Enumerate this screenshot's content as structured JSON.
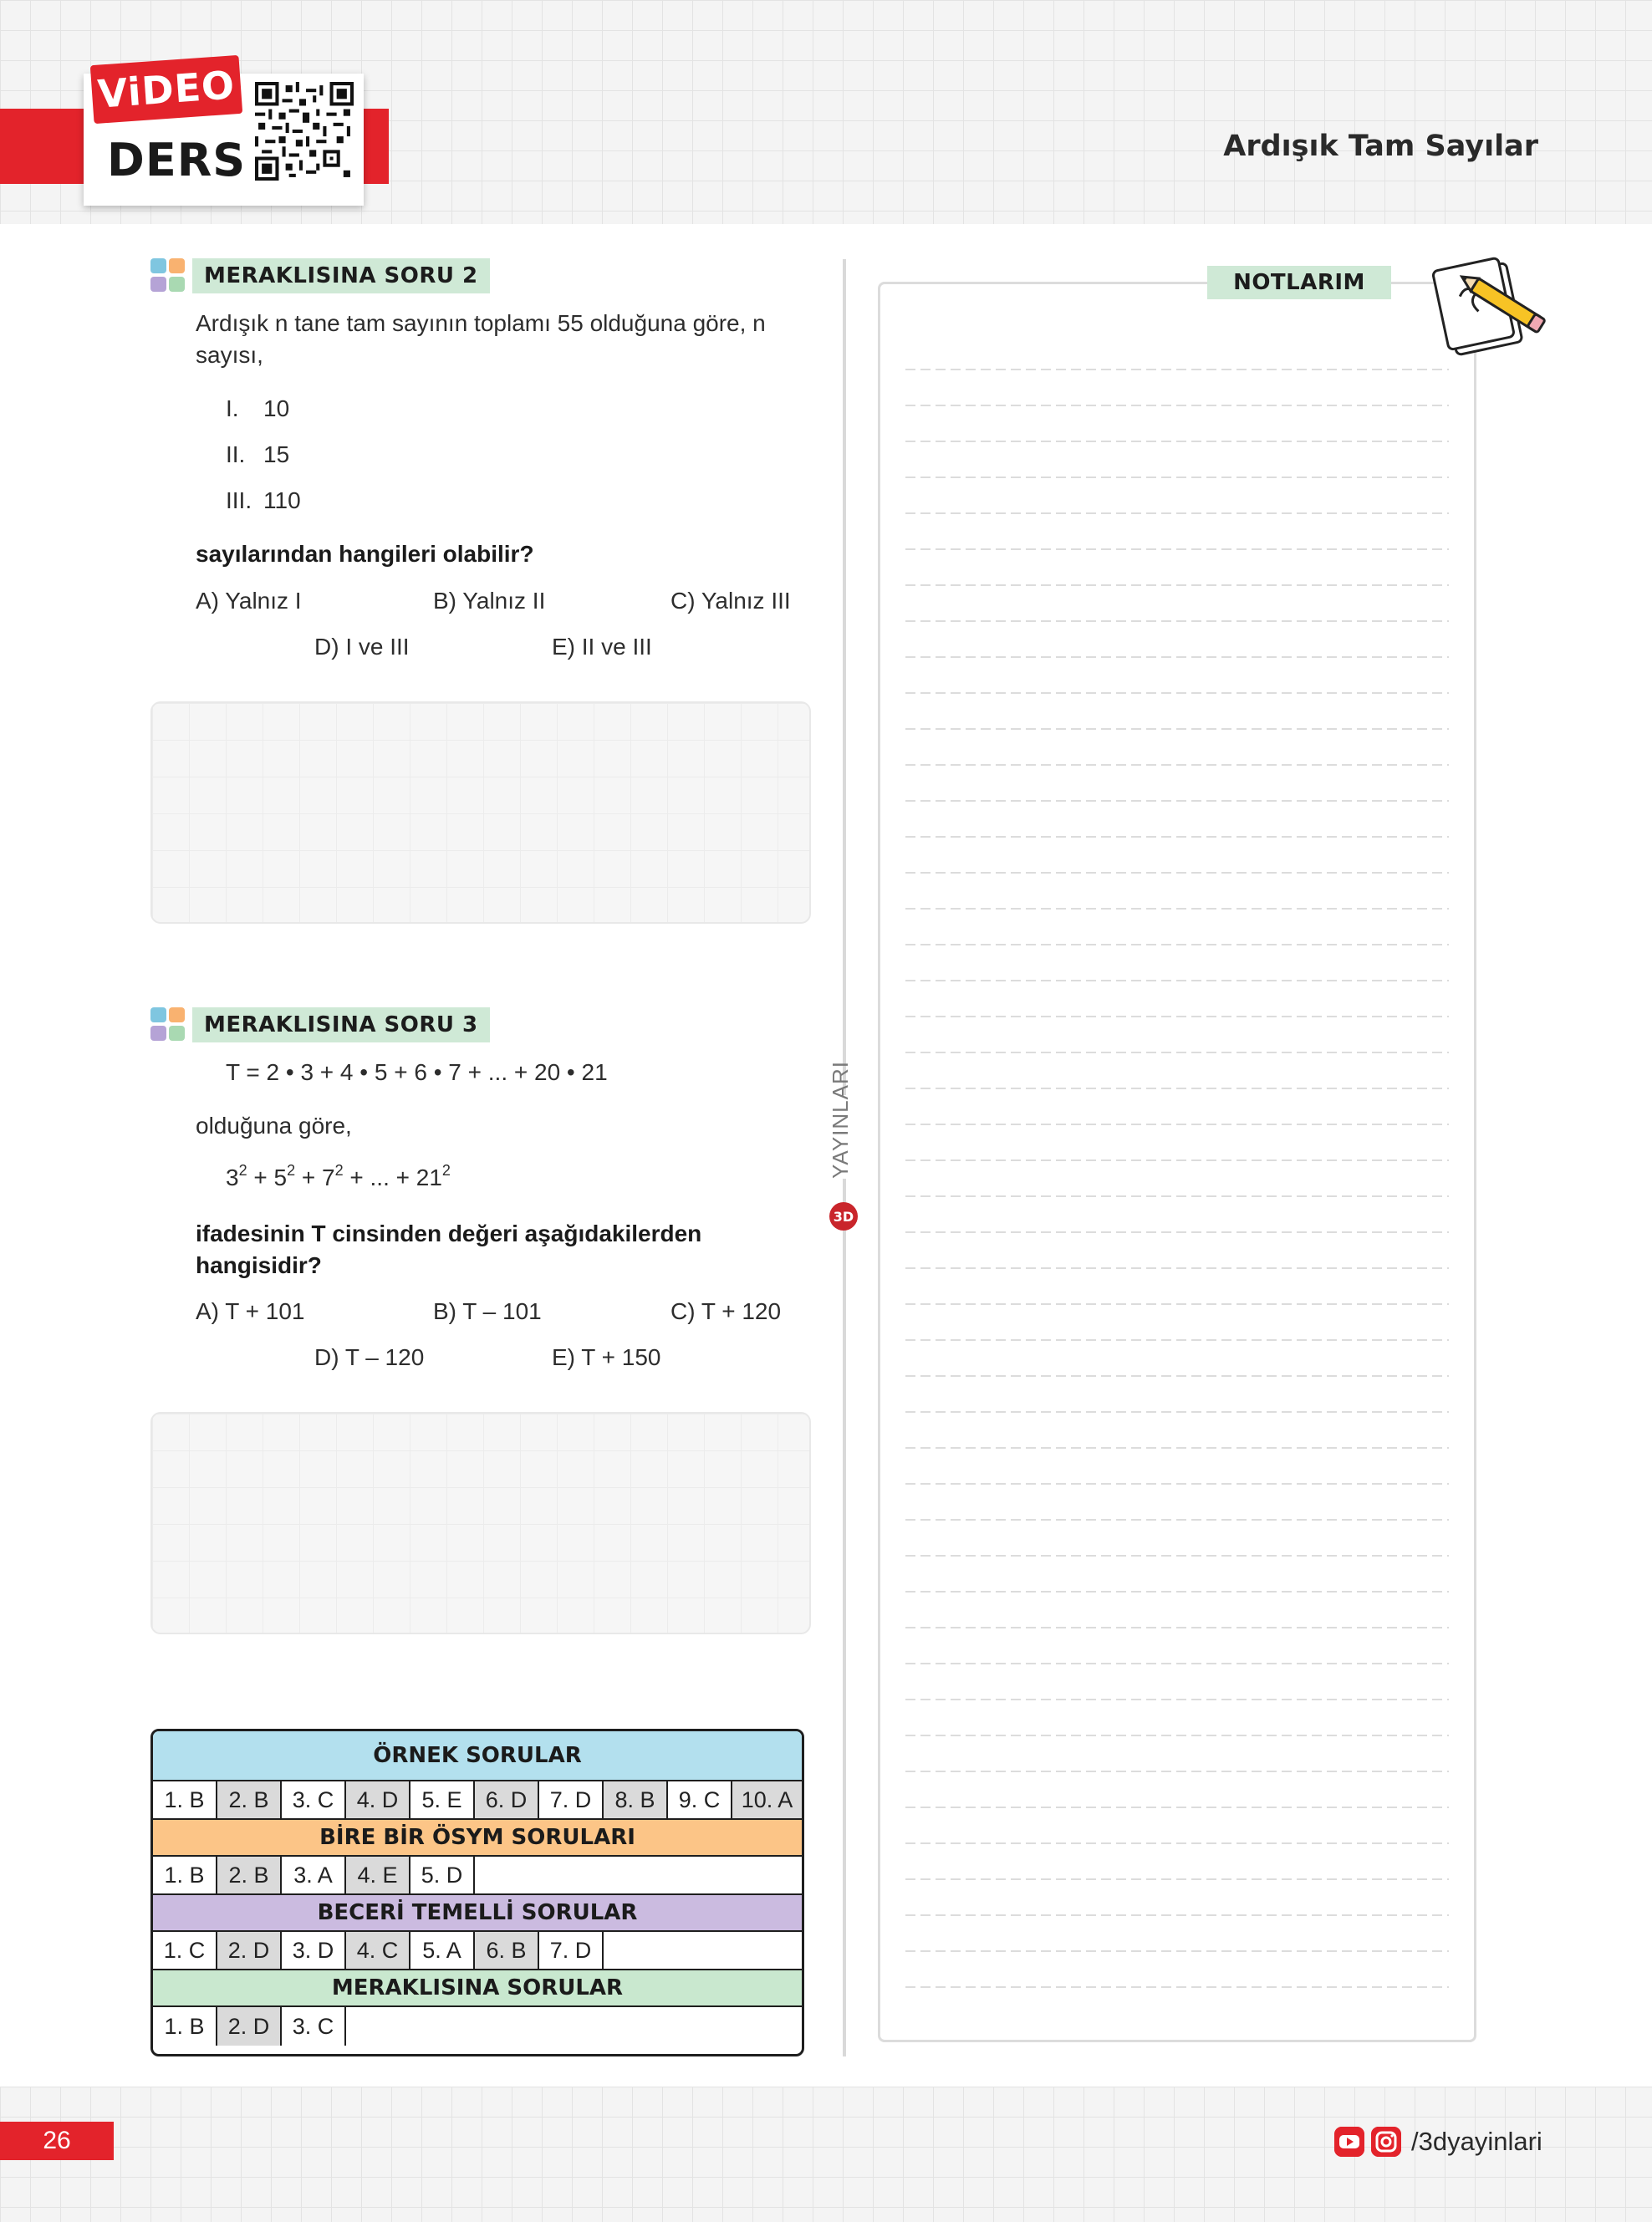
{
  "header": {
    "video_label": "ViDEO",
    "ders_label": "DERS",
    "chapter_title": "Ardışık Tam Sayılar"
  },
  "question2": {
    "label": "MERAKLISINA SORU 2",
    "stem": [
      "Ardışık n tane tam sayının toplamı 55 olduğuna göre, n",
      "sayısı,"
    ],
    "items": [
      {
        "num": "I.",
        "val": "10"
      },
      {
        "num": "II.",
        "val": "15"
      },
      {
        "num": "III.",
        "val": "110"
      }
    ],
    "prompt": "sayılarından hangileri olabilir?",
    "choices": [
      "A) Yalnız I",
      "B) Yalnız II",
      "C) Yalnız III",
      "D) I ve III",
      "E) II ve III"
    ]
  },
  "question3": {
    "label": "MERAKLISINA SORU 3",
    "expression": "T = 2 • 3 + 4 • 5 + 6 • 7 + ... + 20 • 21",
    "given": "olduğuna göre,",
    "sum_terms": [
      {
        "base": "3",
        "exp": "2"
      },
      {
        "base": " + 5",
        "exp": "2"
      },
      {
        "base": " + 7",
        "exp": "2"
      },
      {
        "base": " + ... + 21",
        "exp": "2"
      }
    ],
    "prompt": [
      "ifadesinin T cinsinden değeri aşağıdakilerden",
      "hangisidir?"
    ],
    "choices": [
      "A) T + 101",
      "B) T – 101",
      "C) T + 120",
      "D) T – 120",
      "E) T + 150"
    ]
  },
  "side": {
    "yayinlari": "YAYINLARI",
    "logo": "3D"
  },
  "notes": {
    "label": "NOTLARIM"
  },
  "answer_key": {
    "sections": [
      {
        "title": "ÖRNEK SORULAR",
        "color": "#b3e0ee",
        "answers": [
          "1. B",
          "2. B",
          "3. C",
          "4. D",
          "5. E",
          "6. D",
          "7. D",
          "8. B",
          "9. C",
          "10. A"
        ]
      },
      {
        "title": "BİRE BİR ÖSYM SORULARI",
        "color": "#fcc587",
        "answers": [
          "1. B",
          "2. B",
          "3. A",
          "4. E",
          "5. D"
        ]
      },
      {
        "title": "BECERİ TEMELLİ SORULAR",
        "color": "#cbbbe0",
        "answers": [
          "1. C",
          "2. D",
          "3. D",
          "4. C",
          "5. A",
          "6. B",
          "7. D"
        ]
      },
      {
        "title": "MERAKLISINA SORULAR",
        "color": "#c9e8cf",
        "answers": [
          "1. B",
          "2. D",
          "3. C"
        ]
      }
    ]
  },
  "footer": {
    "page_number": "26",
    "social_handle": "/3dyayinlari"
  },
  "colors": {
    "accent_red": "#e3232b",
    "label_green": "#cfe9d6"
  }
}
